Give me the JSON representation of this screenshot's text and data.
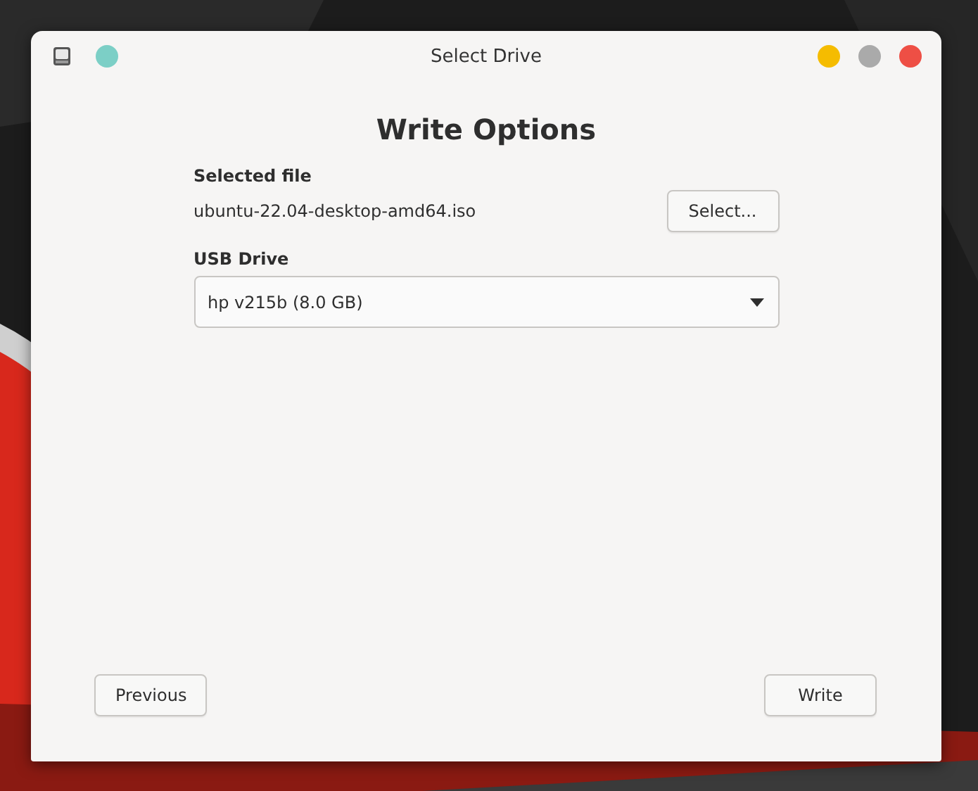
{
  "window": {
    "title": "Select Drive"
  },
  "heading": "Write Options",
  "selected_file": {
    "label": "Selected file",
    "value": "ubuntu-22.04-desktop-amd64.iso",
    "button": "Select..."
  },
  "usb_drive": {
    "label": "USB Drive",
    "value": "hp v215b (8.0 GB)"
  },
  "buttons": {
    "previous": "Previous",
    "next": "Write"
  }
}
